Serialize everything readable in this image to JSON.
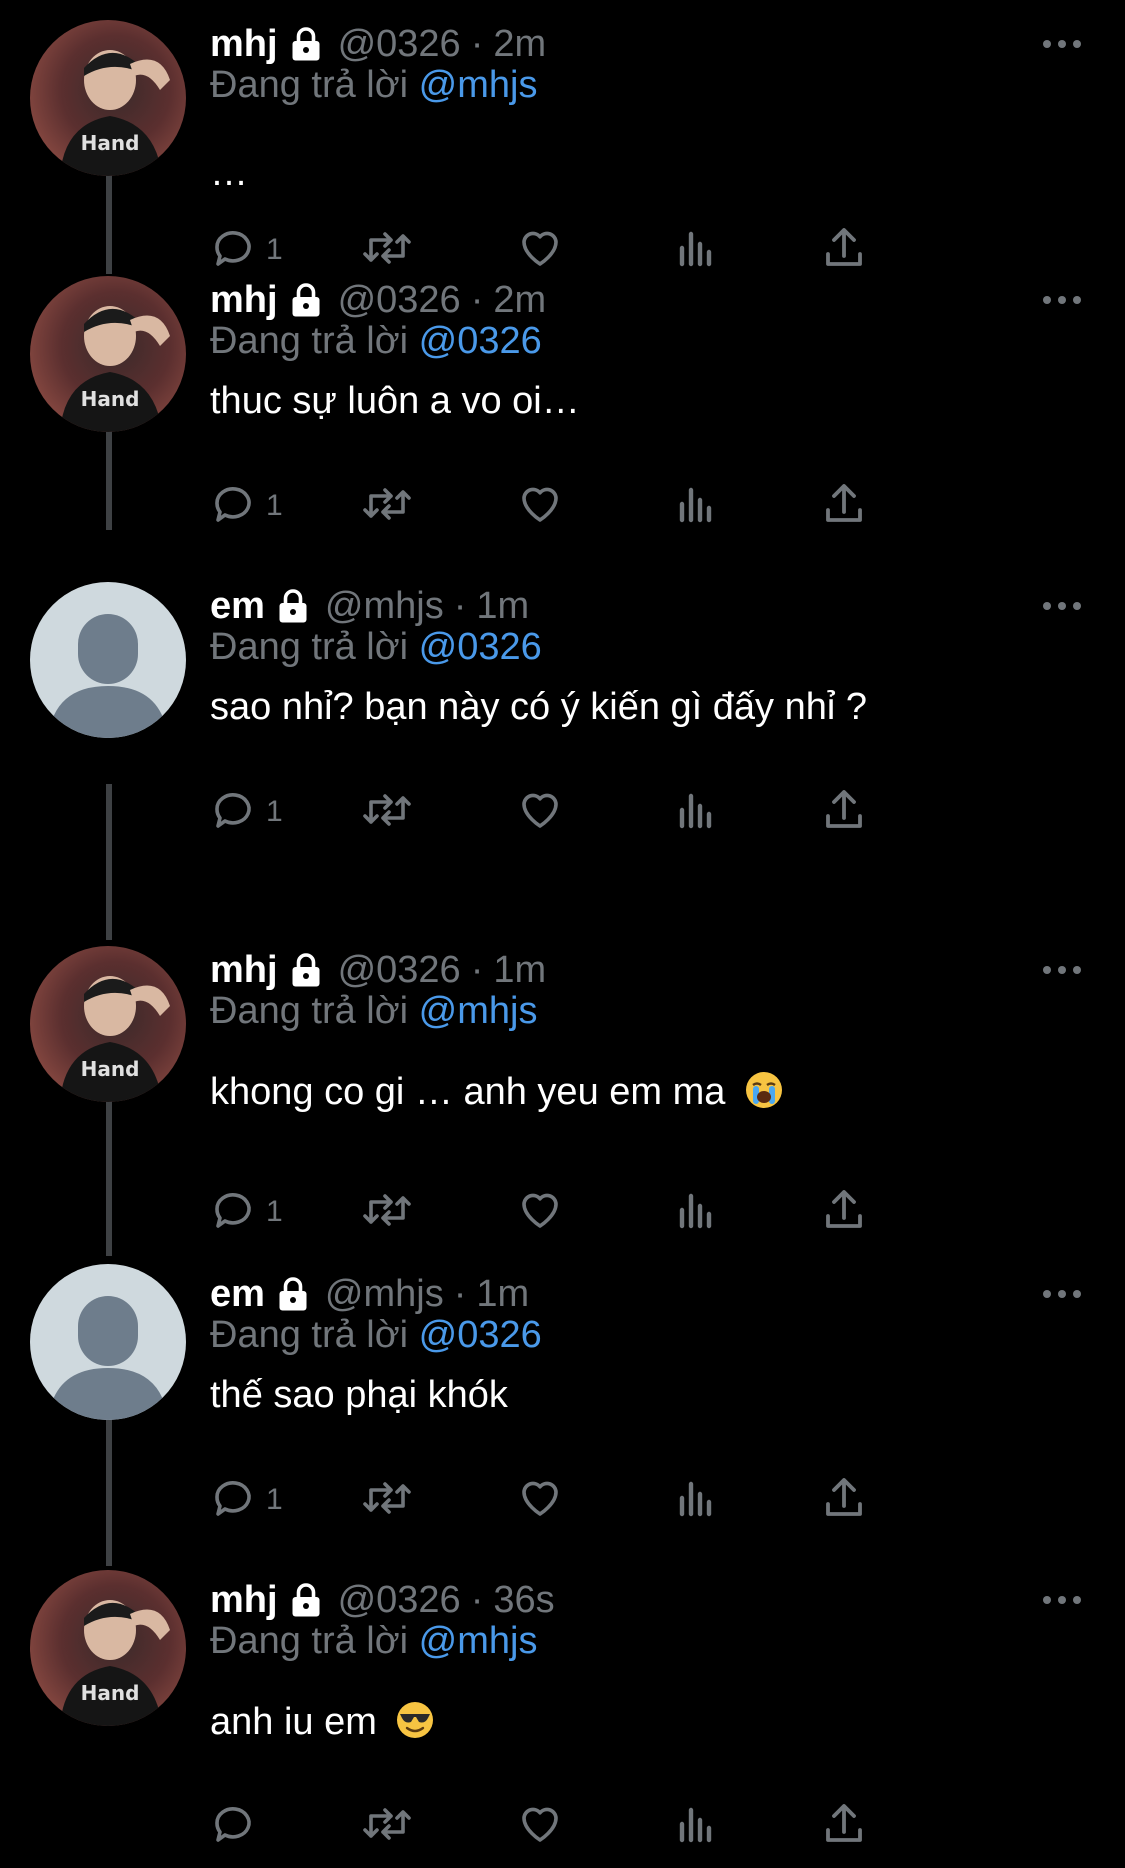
{
  "thread": [
    {
      "name": "mhj",
      "handle": "@0326",
      "time": "2m",
      "reply_prefix": "Đang trả lời",
      "reply_to": "@mhjs",
      "text": "…",
      "reply_count": "1",
      "avatar": "photo"
    },
    {
      "name": "mhj",
      "handle": "@0326",
      "time": "2m",
      "reply_prefix": "Đang trả lời",
      "reply_to": "@0326",
      "text": "thuc sự luôn a vo oi…",
      "reply_count": "1",
      "avatar": "photo"
    },
    {
      "name": "em",
      "handle": "@mhjs",
      "time": "1m",
      "reply_prefix": "Đang trả lời",
      "reply_to": "@0326",
      "text": "sao nhỉ? bạn này có ý kiến gì đấy nhỉ ?",
      "reply_count": "1",
      "avatar": "default"
    },
    {
      "name": "mhj",
      "handle": "@0326",
      "time": "1m",
      "reply_prefix": "Đang trả lời",
      "reply_to": "@mhjs",
      "text": "khong co gi … anh yeu em ma",
      "emoji": "loudly-crying-face",
      "reply_count": "1",
      "avatar": "photo"
    },
    {
      "name": "em",
      "handle": "@mhjs",
      "time": "1m",
      "reply_prefix": "Đang trả lời",
      "reply_to": "@0326",
      "text": "thế sao phại khók",
      "reply_count": "1",
      "avatar": "default"
    },
    {
      "name": "mhj",
      "handle": "@0326",
      "time": "36s",
      "reply_prefix": "Đang trả lời",
      "reply_to": "@mhjs",
      "text": "anh iu em",
      "emoji": "smiling-face-with-sunglasses",
      "reply_count": "",
      "avatar": "photo"
    }
  ],
  "separator": "·",
  "icons": {
    "lock": "lock-icon",
    "more": "more-icon",
    "reply": "reply-icon",
    "retweet": "retweet-icon",
    "like": "heart-icon",
    "views": "views-icon",
    "share": "share-icon"
  },
  "colors": {
    "background": "#000000",
    "text": "#ffffff",
    "secondary": "#71767b",
    "mention": "#4a99e9",
    "thread_line": "#3e4144"
  }
}
